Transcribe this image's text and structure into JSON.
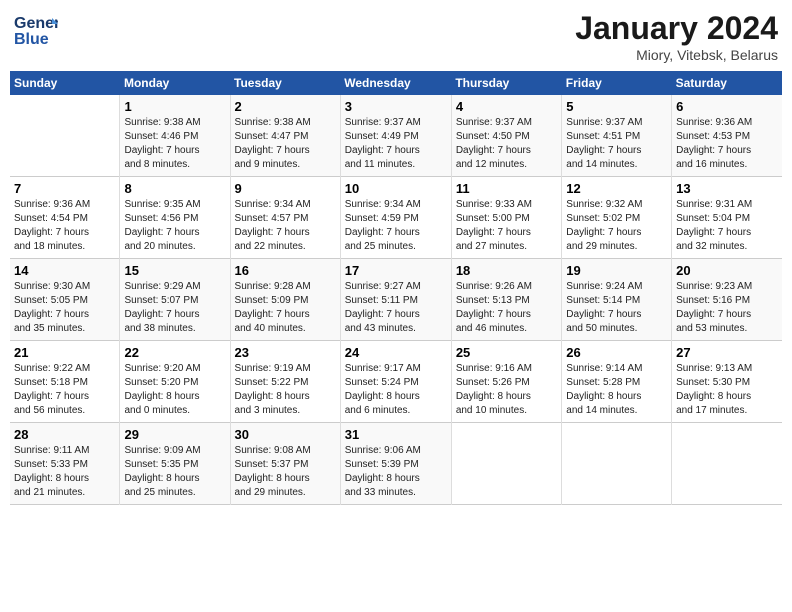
{
  "logo": {
    "line1": "General",
    "line2": "Blue"
  },
  "title": "January 2024",
  "subtitle": "Miory, Vitebsk, Belarus",
  "headers": [
    "Sunday",
    "Monday",
    "Tuesday",
    "Wednesday",
    "Thursday",
    "Friday",
    "Saturday"
  ],
  "weeks": [
    [
      {
        "day": "",
        "info": ""
      },
      {
        "day": "1",
        "info": "Sunrise: 9:38 AM\nSunset: 4:46 PM\nDaylight: 7 hours\nand 8 minutes."
      },
      {
        "day": "2",
        "info": "Sunrise: 9:38 AM\nSunset: 4:47 PM\nDaylight: 7 hours\nand 9 minutes."
      },
      {
        "day": "3",
        "info": "Sunrise: 9:37 AM\nSunset: 4:49 PM\nDaylight: 7 hours\nand 11 minutes."
      },
      {
        "day": "4",
        "info": "Sunrise: 9:37 AM\nSunset: 4:50 PM\nDaylight: 7 hours\nand 12 minutes."
      },
      {
        "day": "5",
        "info": "Sunrise: 9:37 AM\nSunset: 4:51 PM\nDaylight: 7 hours\nand 14 minutes."
      },
      {
        "day": "6",
        "info": "Sunrise: 9:36 AM\nSunset: 4:53 PM\nDaylight: 7 hours\nand 16 minutes."
      }
    ],
    [
      {
        "day": "7",
        "info": "Sunrise: 9:36 AM\nSunset: 4:54 PM\nDaylight: 7 hours\nand 18 minutes."
      },
      {
        "day": "8",
        "info": "Sunrise: 9:35 AM\nSunset: 4:56 PM\nDaylight: 7 hours\nand 20 minutes."
      },
      {
        "day": "9",
        "info": "Sunrise: 9:34 AM\nSunset: 4:57 PM\nDaylight: 7 hours\nand 22 minutes."
      },
      {
        "day": "10",
        "info": "Sunrise: 9:34 AM\nSunset: 4:59 PM\nDaylight: 7 hours\nand 25 minutes."
      },
      {
        "day": "11",
        "info": "Sunrise: 9:33 AM\nSunset: 5:00 PM\nDaylight: 7 hours\nand 27 minutes."
      },
      {
        "day": "12",
        "info": "Sunrise: 9:32 AM\nSunset: 5:02 PM\nDaylight: 7 hours\nand 29 minutes."
      },
      {
        "day": "13",
        "info": "Sunrise: 9:31 AM\nSunset: 5:04 PM\nDaylight: 7 hours\nand 32 minutes."
      }
    ],
    [
      {
        "day": "14",
        "info": "Sunrise: 9:30 AM\nSunset: 5:05 PM\nDaylight: 7 hours\nand 35 minutes."
      },
      {
        "day": "15",
        "info": "Sunrise: 9:29 AM\nSunset: 5:07 PM\nDaylight: 7 hours\nand 38 minutes."
      },
      {
        "day": "16",
        "info": "Sunrise: 9:28 AM\nSunset: 5:09 PM\nDaylight: 7 hours\nand 40 minutes."
      },
      {
        "day": "17",
        "info": "Sunrise: 9:27 AM\nSunset: 5:11 PM\nDaylight: 7 hours\nand 43 minutes."
      },
      {
        "day": "18",
        "info": "Sunrise: 9:26 AM\nSunset: 5:13 PM\nDaylight: 7 hours\nand 46 minutes."
      },
      {
        "day": "19",
        "info": "Sunrise: 9:24 AM\nSunset: 5:14 PM\nDaylight: 7 hours\nand 50 minutes."
      },
      {
        "day": "20",
        "info": "Sunrise: 9:23 AM\nSunset: 5:16 PM\nDaylight: 7 hours\nand 53 minutes."
      }
    ],
    [
      {
        "day": "21",
        "info": "Sunrise: 9:22 AM\nSunset: 5:18 PM\nDaylight: 7 hours\nand 56 minutes."
      },
      {
        "day": "22",
        "info": "Sunrise: 9:20 AM\nSunset: 5:20 PM\nDaylight: 8 hours\nand 0 minutes."
      },
      {
        "day": "23",
        "info": "Sunrise: 9:19 AM\nSunset: 5:22 PM\nDaylight: 8 hours\nand 3 minutes."
      },
      {
        "day": "24",
        "info": "Sunrise: 9:17 AM\nSunset: 5:24 PM\nDaylight: 8 hours\nand 6 minutes."
      },
      {
        "day": "25",
        "info": "Sunrise: 9:16 AM\nSunset: 5:26 PM\nDaylight: 8 hours\nand 10 minutes."
      },
      {
        "day": "26",
        "info": "Sunrise: 9:14 AM\nSunset: 5:28 PM\nDaylight: 8 hours\nand 14 minutes."
      },
      {
        "day": "27",
        "info": "Sunrise: 9:13 AM\nSunset: 5:30 PM\nDaylight: 8 hours\nand 17 minutes."
      }
    ],
    [
      {
        "day": "28",
        "info": "Sunrise: 9:11 AM\nSunset: 5:33 PM\nDaylight: 8 hours\nand 21 minutes."
      },
      {
        "day": "29",
        "info": "Sunrise: 9:09 AM\nSunset: 5:35 PM\nDaylight: 8 hours\nand 25 minutes."
      },
      {
        "day": "30",
        "info": "Sunrise: 9:08 AM\nSunset: 5:37 PM\nDaylight: 8 hours\nand 29 minutes."
      },
      {
        "day": "31",
        "info": "Sunrise: 9:06 AM\nSunset: 5:39 PM\nDaylight: 8 hours\nand 33 minutes."
      },
      {
        "day": "",
        "info": ""
      },
      {
        "day": "",
        "info": ""
      },
      {
        "day": "",
        "info": ""
      }
    ]
  ]
}
